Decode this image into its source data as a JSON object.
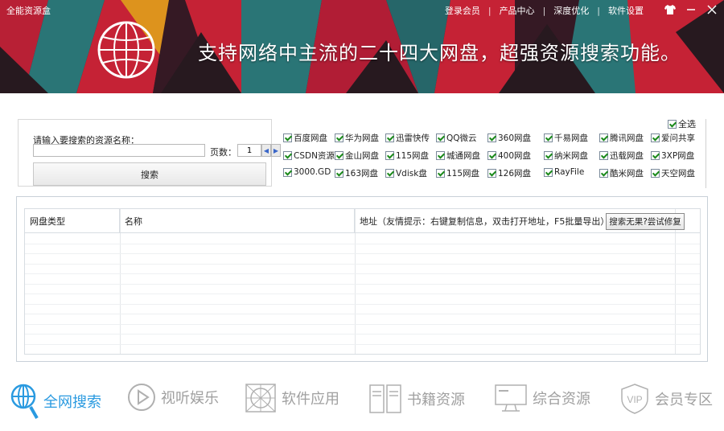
{
  "app": {
    "title": "全能资源盒",
    "slogan": "支持网络中主流的二十四大网盘，超强资源搜索功能。"
  },
  "topnav": {
    "items": [
      "登录会员",
      "产品中心",
      "深度优化",
      "软件设置"
    ]
  },
  "search": {
    "label": "请输入要搜索的资源名称：",
    "value": "",
    "page_label": "页数：",
    "page_value": "1",
    "button_label": "搜索"
  },
  "disks": {
    "select_all_label": "全选",
    "items": [
      "百度网盘",
      "华为网盘",
      "迅雷快传",
      "QQ微云",
      "360网盘",
      "千易网盘",
      "腾讯网盘",
      "爱问共享",
      "CSDN资源",
      "金山网盘",
      "115网盘",
      "城通网盘",
      "400网盘",
      "纳米网盘",
      "迅载网盘",
      "3XP网盘",
      "3000.GD",
      "163网盘",
      "Vdisk盘",
      "115网盘",
      "126网盘",
      "RayFile",
      "酷米网盘",
      "天空网盘"
    ]
  },
  "table": {
    "columns": [
      "网盘类型",
      "名称",
      "地址（友情提示：右键复制信息，双击打开地址，F5批量导出）"
    ],
    "fix_button_label": "搜索无果?尝试修复"
  },
  "bottom_nav": {
    "items": [
      {
        "label": "全网搜索",
        "icon": "globe-search-icon",
        "active": true
      },
      {
        "label": "视听娱乐",
        "icon": "play-icon",
        "active": false
      },
      {
        "label": "软件应用",
        "icon": "app-grid-icon",
        "active": false
      },
      {
        "label": "书籍资源",
        "icon": "book-icon",
        "active": false
      },
      {
        "label": "综合资源",
        "icon": "monitor-icon",
        "active": false
      },
      {
        "label": "会员专区",
        "icon": "vip-shield-icon",
        "active": false
      }
    ]
  },
  "colors": {
    "accent": "#2a9ae0",
    "banner_red": "#d6253a",
    "banner_teal": "#2e7f80",
    "banner_orange": "#f0a020",
    "checkbox_green": "#1b8a1b"
  }
}
